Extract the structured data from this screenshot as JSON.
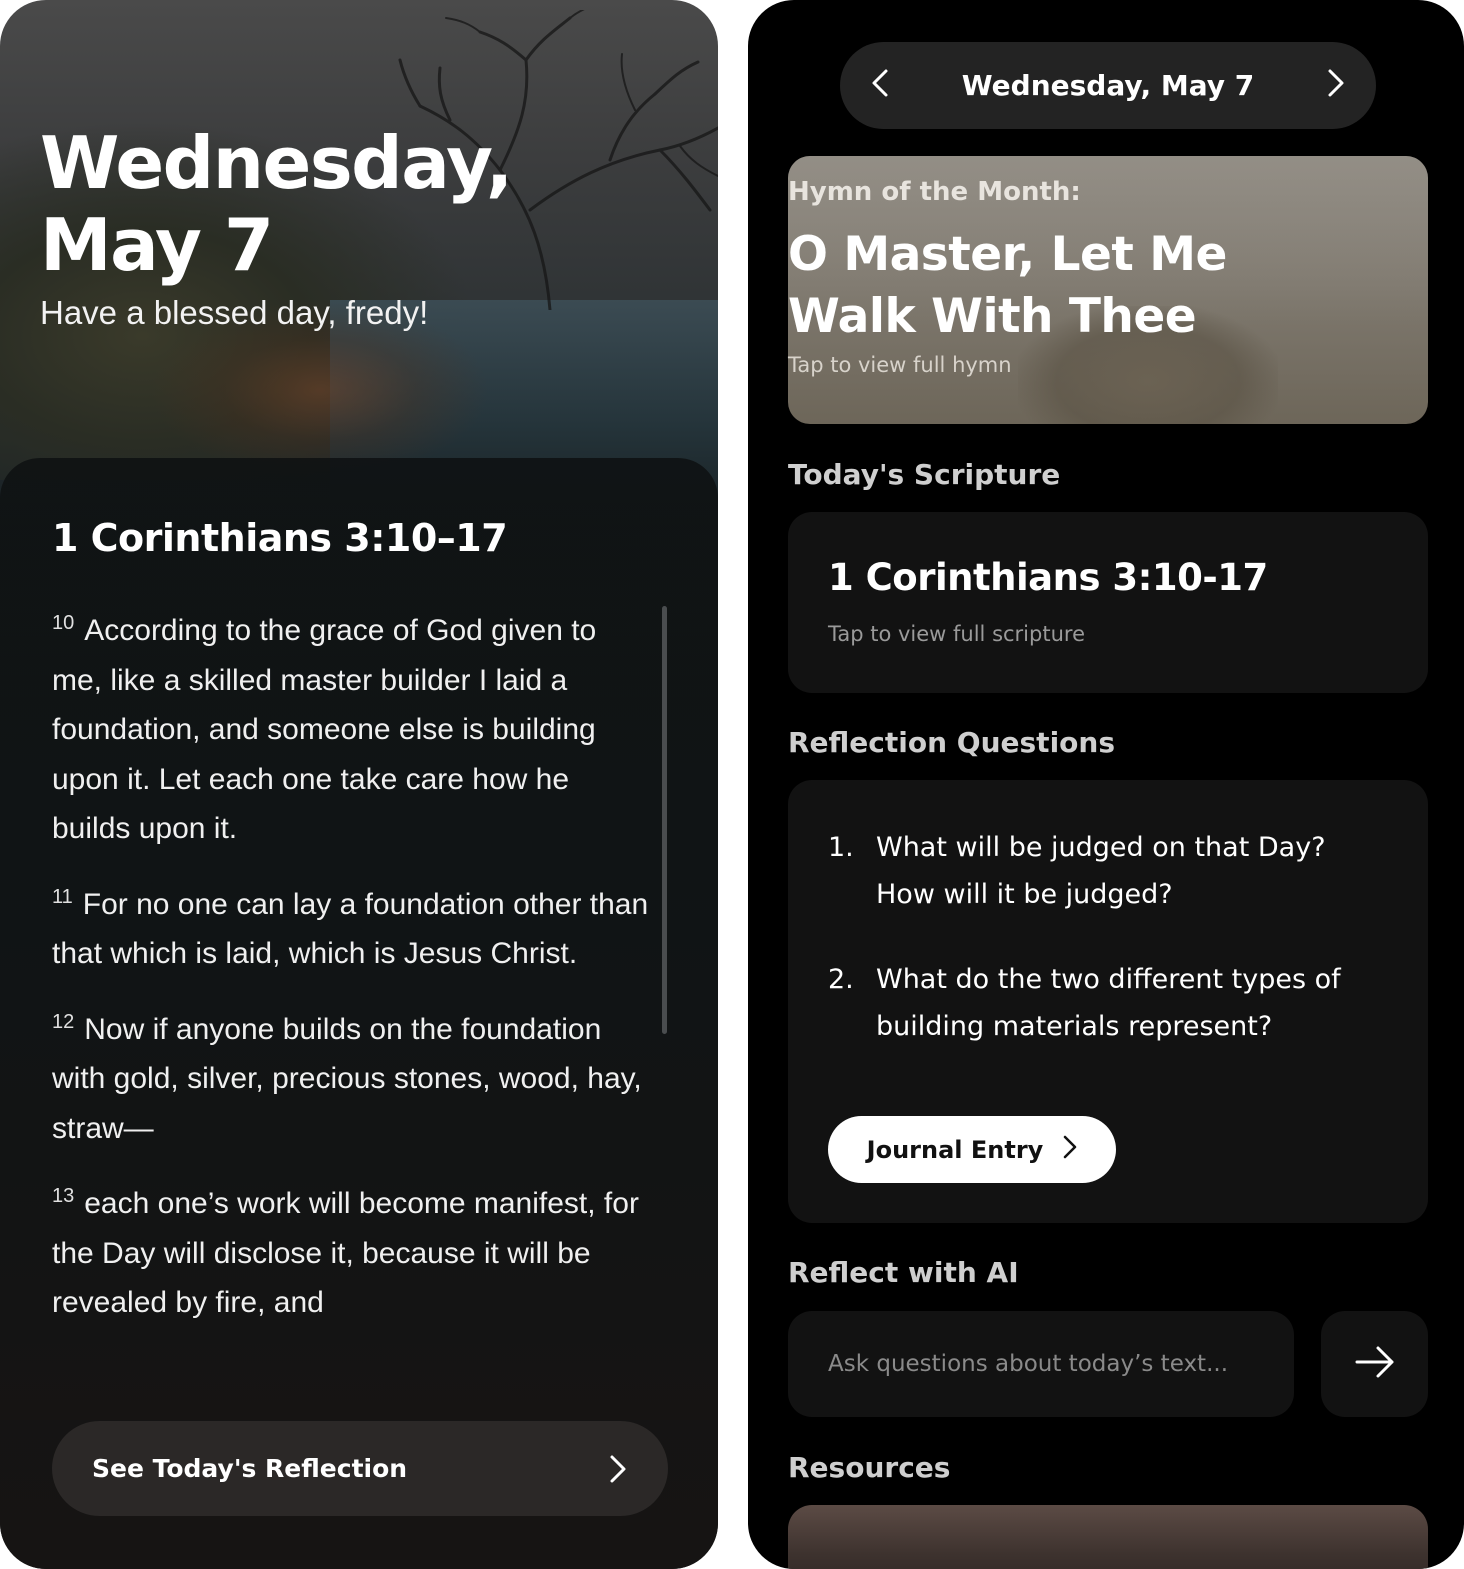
{
  "home": {
    "title": "Wednesday, May 7",
    "greeting": "Have a blessed day, fredy!",
    "passage_reference": "1 Corinthians 3:10–17",
    "verses": [
      {
        "num": "10",
        "text": "According to the grace of God given to me, like a skilled master builder I laid a foundation, and someone else is building upon it. Let each one take care how he builds upon it."
      },
      {
        "num": "11",
        "text": "For no one can lay a foundation other than that which is laid, which is Jesus Christ."
      },
      {
        "num": "12",
        "text": "Now if anyone builds on the foundation with gold, silver, precious stones, wood, hay, straw—"
      },
      {
        "num": "13",
        "text": "each one’s work will become manifest, for the Day will disclose it, because it will be revealed by fire, and"
      }
    ],
    "reflection_button": "See Today's Reflection",
    "icons": {
      "background": "tree-branches-icon",
      "chevron": "chevron-right-icon"
    }
  },
  "detail": {
    "date_nav": {
      "label": "Wednesday, May 7",
      "prev_icon": "chevron-left-icon",
      "next_icon": "chevron-right-icon"
    },
    "hymn": {
      "label": "Hymn of the Month:",
      "title": "O Master, Let Me Walk With Thee",
      "tap_hint": "Tap to view full hymn"
    },
    "scripture_section": "Today's Scripture",
    "scripture": {
      "reference": "1 Corinthians 3:10-17",
      "tap_hint": "Tap to view full scripture"
    },
    "reflection_section": "Reflection Questions",
    "questions": [
      {
        "num": "1.",
        "text": "What will be judged on that Day? How will it be judged?"
      },
      {
        "num": "2.",
        "text": "What do the two different types of building materials represent?"
      }
    ],
    "journal_button": "Journal Entry",
    "ai_section": "Reflect with AI",
    "ai_placeholder": "Ask questions about today’s text...",
    "send_icon": "arrow-right-icon",
    "resources_section": "Resources"
  },
  "colors": {
    "background": "#000000",
    "card": "#121212",
    "pill": "#232323",
    "text": "#ffffff",
    "muted": "#9a9a9a",
    "button_light": "#ffffff",
    "button_dark": "#2b2827"
  }
}
